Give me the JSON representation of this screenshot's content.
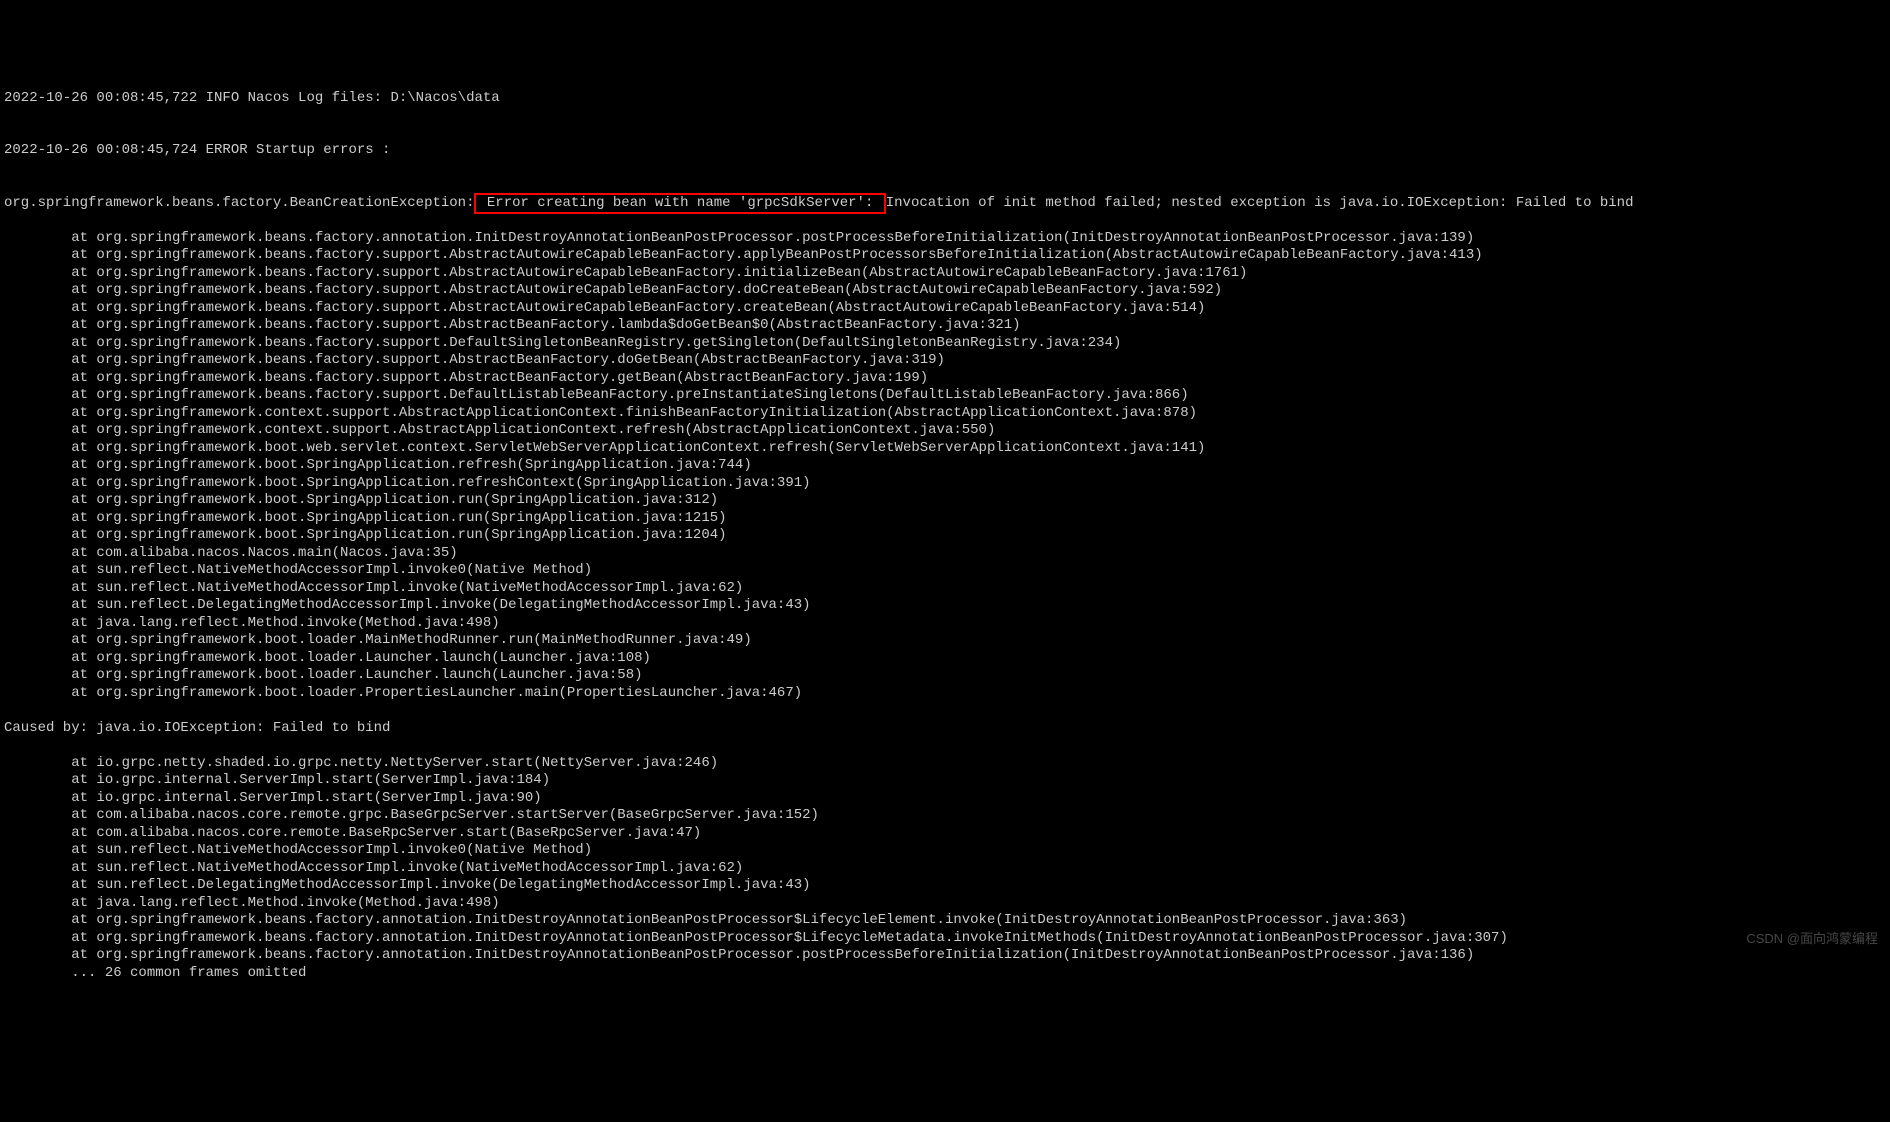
{
  "log": {
    "line1": "2022-10-26 00:08:45,722 INFO Nacos Log files: D:\\Nacos\\data",
    "blank1": "",
    "line2": "2022-10-26 00:08:45,724 ERROR Startup errors : ",
    "blank2": "",
    "exception_prefix": "org.springframework.beans.factory.BeanCreationException:",
    "exception_highlight": " Error creating bean with name 'grpcSdkServer': ",
    "exception_suffix": "Invocation of init method failed; nested exception is java.io.IOException: Failed to bind",
    "stack1": [
      "        at org.springframework.beans.factory.annotation.InitDestroyAnnotationBeanPostProcessor.postProcessBeforeInitialization(InitDestroyAnnotationBeanPostProcessor.java:139)",
      "        at org.springframework.beans.factory.support.AbstractAutowireCapableBeanFactory.applyBeanPostProcessorsBeforeInitialization(AbstractAutowireCapableBeanFactory.java:413)",
      "        at org.springframework.beans.factory.support.AbstractAutowireCapableBeanFactory.initializeBean(AbstractAutowireCapableBeanFactory.java:1761)",
      "        at org.springframework.beans.factory.support.AbstractAutowireCapableBeanFactory.doCreateBean(AbstractAutowireCapableBeanFactory.java:592)",
      "        at org.springframework.beans.factory.support.AbstractAutowireCapableBeanFactory.createBean(AbstractAutowireCapableBeanFactory.java:514)",
      "        at org.springframework.beans.factory.support.AbstractBeanFactory.lambda$doGetBean$0(AbstractBeanFactory.java:321)",
      "        at org.springframework.beans.factory.support.DefaultSingletonBeanRegistry.getSingleton(DefaultSingletonBeanRegistry.java:234)",
      "        at org.springframework.beans.factory.support.AbstractBeanFactory.doGetBean(AbstractBeanFactory.java:319)",
      "        at org.springframework.beans.factory.support.AbstractBeanFactory.getBean(AbstractBeanFactory.java:199)",
      "        at org.springframework.beans.factory.support.DefaultListableBeanFactory.preInstantiateSingletons(DefaultListableBeanFactory.java:866)",
      "        at org.springframework.context.support.AbstractApplicationContext.finishBeanFactoryInitialization(AbstractApplicationContext.java:878)",
      "        at org.springframework.context.support.AbstractApplicationContext.refresh(AbstractApplicationContext.java:550)",
      "        at org.springframework.boot.web.servlet.context.ServletWebServerApplicationContext.refresh(ServletWebServerApplicationContext.java:141)",
      "        at org.springframework.boot.SpringApplication.refresh(SpringApplication.java:744)",
      "        at org.springframework.boot.SpringApplication.refreshContext(SpringApplication.java:391)",
      "        at org.springframework.boot.SpringApplication.run(SpringApplication.java:312)",
      "        at org.springframework.boot.SpringApplication.run(SpringApplication.java:1215)",
      "        at org.springframework.boot.SpringApplication.run(SpringApplication.java:1204)",
      "        at com.alibaba.nacos.Nacos.main(Nacos.java:35)",
      "        at sun.reflect.NativeMethodAccessorImpl.invoke0(Native Method)",
      "        at sun.reflect.NativeMethodAccessorImpl.invoke(NativeMethodAccessorImpl.java:62)",
      "        at sun.reflect.DelegatingMethodAccessorImpl.invoke(DelegatingMethodAccessorImpl.java:43)",
      "        at java.lang.reflect.Method.invoke(Method.java:498)",
      "        at org.springframework.boot.loader.MainMethodRunner.run(MainMethodRunner.java:49)",
      "        at org.springframework.boot.loader.Launcher.launch(Launcher.java:108)",
      "        at org.springframework.boot.loader.Launcher.launch(Launcher.java:58)",
      "        at org.springframework.boot.loader.PropertiesLauncher.main(PropertiesLauncher.java:467)"
    ],
    "caused_by": "Caused by: java.io.IOException: Failed to bind",
    "stack2": [
      "        at io.grpc.netty.shaded.io.grpc.netty.NettyServer.start(NettyServer.java:246)",
      "        at io.grpc.internal.ServerImpl.start(ServerImpl.java:184)",
      "        at io.grpc.internal.ServerImpl.start(ServerImpl.java:90)",
      "        at com.alibaba.nacos.core.remote.grpc.BaseGrpcServer.startServer(BaseGrpcServer.java:152)",
      "        at com.alibaba.nacos.core.remote.BaseRpcServer.start(BaseRpcServer.java:47)",
      "        at sun.reflect.NativeMethodAccessorImpl.invoke0(Native Method)",
      "        at sun.reflect.NativeMethodAccessorImpl.invoke(NativeMethodAccessorImpl.java:62)",
      "        at sun.reflect.DelegatingMethodAccessorImpl.invoke(DelegatingMethodAccessorImpl.java:43)",
      "        at java.lang.reflect.Method.invoke(Method.java:498)",
      "        at org.springframework.beans.factory.annotation.InitDestroyAnnotationBeanPostProcessor$LifecycleElement.invoke(InitDestroyAnnotationBeanPostProcessor.java:363)",
      "        at org.springframework.beans.factory.annotation.InitDestroyAnnotationBeanPostProcessor$LifecycleMetadata.invokeInitMethods(InitDestroyAnnotationBeanPostProcessor.java:307)",
      "        at org.springframework.beans.factory.annotation.InitDestroyAnnotationBeanPostProcessor.postProcessBeforeInitialization(InitDestroyAnnotationBeanPostProcessor.java:136)",
      "        ... 26 common frames omitted"
    ]
  },
  "watermark": "CSDN @面向鸿蒙编程"
}
